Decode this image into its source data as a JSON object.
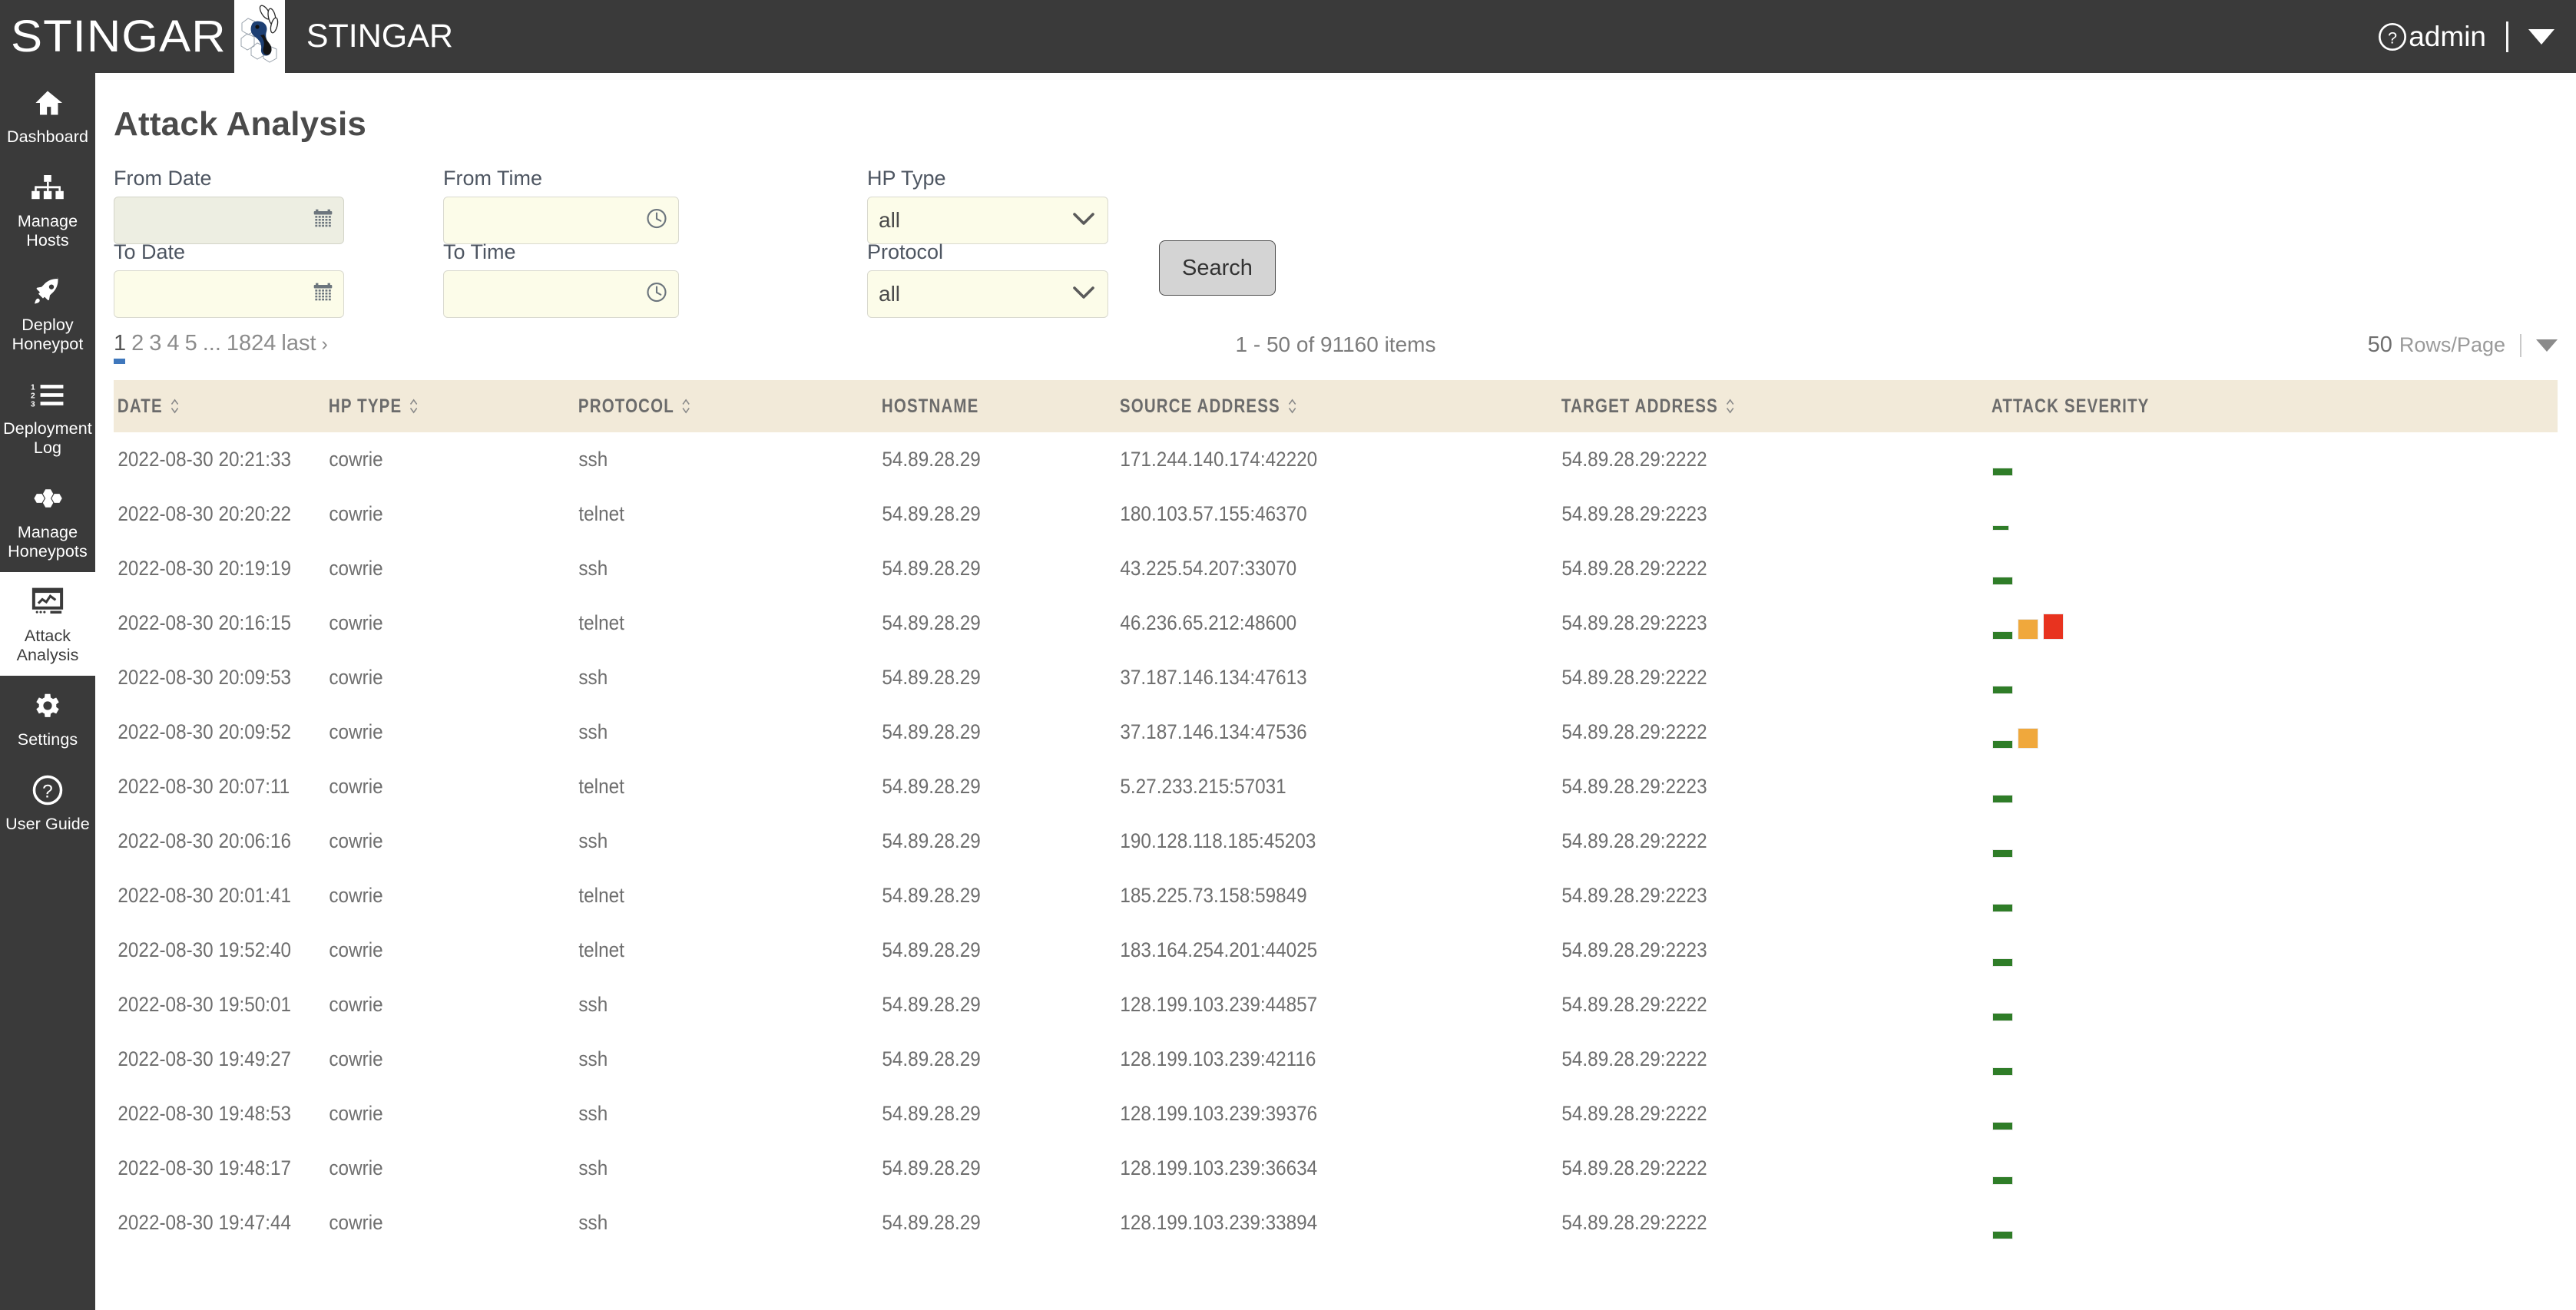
{
  "topbar": {
    "wordmark": "STINGAR",
    "brand_text": "STINGAR",
    "help_icon": "question-circle-icon",
    "user_label": "admin",
    "caret_icon": "caret-down-icon"
  },
  "sidebar": {
    "items": [
      {
        "label": "Dashboard",
        "icon": "home-icon",
        "active": false
      },
      {
        "label": "Manage\nHosts",
        "icon": "sitemap-icon",
        "active": false
      },
      {
        "label": "Deploy\nHoneypot",
        "icon": "rocket-icon",
        "active": false
      },
      {
        "label": "Deployment\nLog",
        "icon": "list-ol-icon",
        "active": false
      },
      {
        "label": "Manage\nHoneypots",
        "icon": "honeycomb-icon",
        "active": false
      },
      {
        "label": "Attack\nAnalysis",
        "icon": "chart-monitor-icon",
        "active": true
      },
      {
        "label": "Settings",
        "icon": "gear-icon",
        "active": false
      },
      {
        "label": "User Guide",
        "icon": "question-circle-icon",
        "active": false
      }
    ]
  },
  "page": {
    "title": "Attack Analysis"
  },
  "filters": {
    "from_date": {
      "label": "From Date",
      "value": "",
      "placeholder": "",
      "icon": "calendar-icon"
    },
    "to_date": {
      "label": "To Date",
      "value": "",
      "placeholder": "",
      "icon": "calendar-icon"
    },
    "from_time": {
      "label": "From Time",
      "value": "",
      "placeholder": "",
      "icon": "clock-icon"
    },
    "to_time": {
      "label": "To Time",
      "value": "",
      "placeholder": "",
      "icon": "clock-icon"
    },
    "hp_type": {
      "label": "HP Type",
      "value": "all",
      "options": [
        "all"
      ],
      "icon": "chevron-down-icon"
    },
    "protocol": {
      "label": "Protocol",
      "value": "all",
      "options": [
        "all"
      ],
      "icon": "chevron-down-icon"
    },
    "search_button": "Search"
  },
  "pagination": {
    "pages": [
      "1",
      "2",
      "3",
      "4",
      "5",
      "...",
      "1824",
      "last"
    ],
    "active_page": "1",
    "next_arrow": "›",
    "items_text": "1 - 50 of 91160 items",
    "rows_per_page_value": "50",
    "rows_per_page_label": "Rows/Page",
    "rows_caret_icon": "caret-down-icon"
  },
  "table": {
    "columns": [
      {
        "label": "DATE",
        "sortable": true
      },
      {
        "label": "HP TYPE",
        "sortable": true
      },
      {
        "label": "PROTOCOL",
        "sortable": true
      },
      {
        "label": "HOSTNAME",
        "sortable": false
      },
      {
        "label": "SOURCE ADDRESS",
        "sortable": true
      },
      {
        "label": "TARGET ADDRESS",
        "sortable": true
      },
      {
        "label": "ATTACK SEVERITY",
        "sortable": false
      }
    ],
    "severity_colors": {
      "low": "#2f7d28",
      "medium": "#f0a83c",
      "high": "#e8331f"
    },
    "rows": [
      {
        "date": "2022-08-30 20:21:33",
        "hp_type": "cowrie",
        "protocol": "ssh",
        "hostname": "54.89.28.29",
        "source": "171.244.140.174:42220",
        "target": "54.89.28.29:2222",
        "severity": [
          "low"
        ]
      },
      {
        "date": "2022-08-30 20:20:22",
        "hp_type": "cowrie",
        "protocol": "telnet",
        "hostname": "54.89.28.29",
        "source": "180.103.57.155:46370",
        "target": "54.89.28.29:2223",
        "severity": [
          "low-thin"
        ]
      },
      {
        "date": "2022-08-30 20:19:19",
        "hp_type": "cowrie",
        "protocol": "ssh",
        "hostname": "54.89.28.29",
        "source": "43.225.54.207:33070",
        "target": "54.89.28.29:2222",
        "severity": [
          "low"
        ]
      },
      {
        "date": "2022-08-30 20:16:15",
        "hp_type": "cowrie",
        "protocol": "telnet",
        "hostname": "54.89.28.29",
        "source": "46.236.65.212:48600",
        "target": "54.89.28.29:2223",
        "severity": [
          "low",
          "medium",
          "high"
        ]
      },
      {
        "date": "2022-08-30 20:09:53",
        "hp_type": "cowrie",
        "protocol": "ssh",
        "hostname": "54.89.28.29",
        "source": "37.187.146.134:47613",
        "target": "54.89.28.29:2222",
        "severity": [
          "low"
        ]
      },
      {
        "date": "2022-08-30 20:09:52",
        "hp_type": "cowrie",
        "protocol": "ssh",
        "hostname": "54.89.28.29",
        "source": "37.187.146.134:47536",
        "target": "54.89.28.29:2222",
        "severity": [
          "low",
          "medium"
        ]
      },
      {
        "date": "2022-08-30 20:07:11",
        "hp_type": "cowrie",
        "protocol": "telnet",
        "hostname": "54.89.28.29",
        "source": "5.27.233.215:57031",
        "target": "54.89.28.29:2223",
        "severity": [
          "low"
        ]
      },
      {
        "date": "2022-08-30 20:06:16",
        "hp_type": "cowrie",
        "protocol": "ssh",
        "hostname": "54.89.28.29",
        "source": "190.128.118.185:45203",
        "target": "54.89.28.29:2222",
        "severity": [
          "low"
        ]
      },
      {
        "date": "2022-08-30 20:01:41",
        "hp_type": "cowrie",
        "protocol": "telnet",
        "hostname": "54.89.28.29",
        "source": "185.225.73.158:59849",
        "target": "54.89.28.29:2223",
        "severity": [
          "low"
        ]
      },
      {
        "date": "2022-08-30 19:52:40",
        "hp_type": "cowrie",
        "protocol": "telnet",
        "hostname": "54.89.28.29",
        "source": "183.164.254.201:44025",
        "target": "54.89.28.29:2223",
        "severity": [
          "low"
        ]
      },
      {
        "date": "2022-08-30 19:50:01",
        "hp_type": "cowrie",
        "protocol": "ssh",
        "hostname": "54.89.28.29",
        "source": "128.199.103.239:44857",
        "target": "54.89.28.29:2222",
        "severity": [
          "low"
        ]
      },
      {
        "date": "2022-08-30 19:49:27",
        "hp_type": "cowrie",
        "protocol": "ssh",
        "hostname": "54.89.28.29",
        "source": "128.199.103.239:42116",
        "target": "54.89.28.29:2222",
        "severity": [
          "low"
        ]
      },
      {
        "date": "2022-08-30 19:48:53",
        "hp_type": "cowrie",
        "protocol": "ssh",
        "hostname": "54.89.28.29",
        "source": "128.199.103.239:39376",
        "target": "54.89.28.29:2222",
        "severity": [
          "low"
        ]
      },
      {
        "date": "2022-08-30 19:48:17",
        "hp_type": "cowrie",
        "protocol": "ssh",
        "hostname": "54.89.28.29",
        "source": "128.199.103.239:36634",
        "target": "54.89.28.29:2222",
        "severity": [
          "low"
        ]
      },
      {
        "date": "2022-08-30 19:47:44",
        "hp_type": "cowrie",
        "protocol": "ssh",
        "hostname": "54.89.28.29",
        "source": "128.199.103.239:33894",
        "target": "54.89.28.29:2222",
        "severity": [
          "low"
        ]
      }
    ]
  }
}
